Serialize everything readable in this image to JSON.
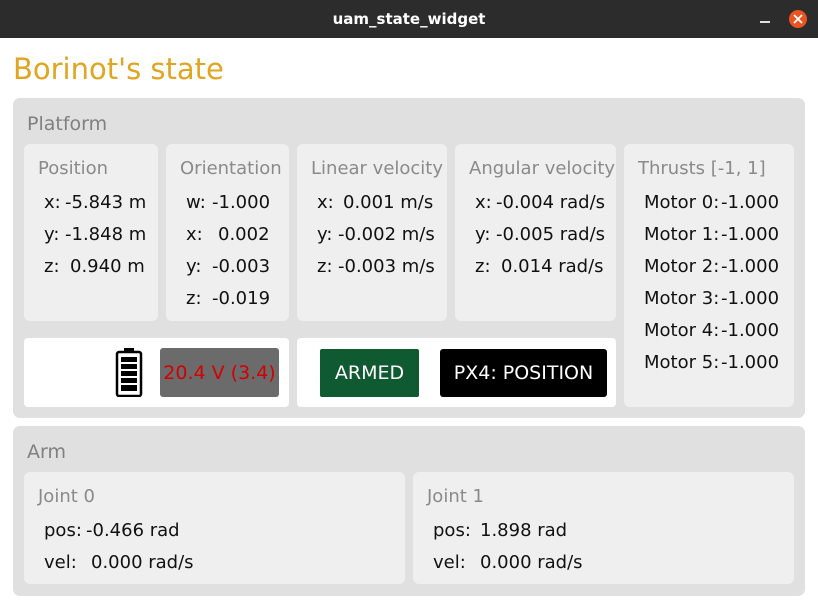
{
  "window": {
    "title": "uam_state_widget"
  },
  "app_title": "Borinot's state",
  "platform": {
    "title": "Platform",
    "position": {
      "title": "Position",
      "rows": [
        {
          "key": "x:",
          "value": "-5.843 m"
        },
        {
          "key": "y:",
          "value": "-1.848 m"
        },
        {
          "key": "z:",
          "value": "0.940 m"
        }
      ]
    },
    "orientation": {
      "title": "Orientation",
      "rows": [
        {
          "key": "w:",
          "value": "-1.000"
        },
        {
          "key": "x:",
          "value": "0.002"
        },
        {
          "key": "y:",
          "value": "-0.003"
        },
        {
          "key": "z:",
          "value": "-0.019"
        }
      ]
    },
    "linear_velocity": {
      "title": "Linear velocity",
      "rows": [
        {
          "key": "x:",
          "value": "0.001 m/s"
        },
        {
          "key": "y:",
          "value": "-0.002 m/s"
        },
        {
          "key": "z:",
          "value": "-0.003 m/s"
        }
      ]
    },
    "angular_velocity": {
      "title": "Angular velocity",
      "rows": [
        {
          "key": "x:",
          "value": "-0.004 rad/s"
        },
        {
          "key": "y:",
          "value": "-0.005 rad/s"
        },
        {
          "key": "z:",
          "value": "0.014 rad/s"
        }
      ]
    },
    "thrusts": {
      "title": "Thrusts [-1, 1]",
      "rows": [
        {
          "key": "Motor 0:",
          "value": "-1.000"
        },
        {
          "key": "Motor 1:",
          "value": "-1.000"
        },
        {
          "key": "Motor 2:",
          "value": "-1.000"
        },
        {
          "key": "Motor 3:",
          "value": "-1.000"
        },
        {
          "key": "Motor 4:",
          "value": "-1.000"
        },
        {
          "key": "Motor 5:",
          "value": "-1.000"
        }
      ]
    },
    "battery": {
      "icon": "battery-icon",
      "text": "20.4 V (3.4)",
      "text_color": "#d40000"
    },
    "armed": {
      "label": "ARMED",
      "color": "#0f5a31"
    },
    "flight_mode": {
      "label": "PX4: POSITION"
    }
  },
  "arm": {
    "title": "Arm",
    "joint0": {
      "title": "Joint 0",
      "rows": [
        {
          "key": "pos:",
          "value": "-0.466 rad"
        },
        {
          "key": "vel:",
          "value": "0.000 rad/s"
        }
      ]
    },
    "joint1": {
      "title": "Joint 1",
      "rows": [
        {
          "key": "pos:",
          "value": "1.898 rad"
        },
        {
          "key": "vel:",
          "value": "0.000 rad/s"
        }
      ]
    }
  },
  "colors": {
    "title_accent": "#e0a521",
    "titlebar": "#2c2c2c",
    "close_button": "#e95420"
  }
}
